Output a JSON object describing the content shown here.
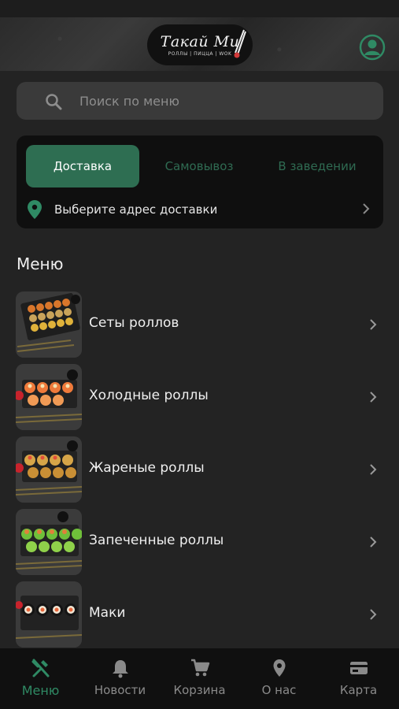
{
  "header": {
    "brand_name": "Такай Ми",
    "brand_tagline": "РОЛЛЫ | ПИЦЦА | WOK",
    "profile_icon": "user-circle-icon"
  },
  "search": {
    "placeholder": "Поиск по меню",
    "icon": "search-icon"
  },
  "delivery": {
    "tabs": [
      {
        "label": "Доставка",
        "active": true
      },
      {
        "label": "Самовывоз",
        "active": false
      },
      {
        "label": "В заведении",
        "active": false
      }
    ],
    "address_prompt": "Выберите адрес доставки",
    "address_icon": "map-pin-icon"
  },
  "menu": {
    "title": "Меню",
    "items": [
      {
        "label": "Сеты роллов"
      },
      {
        "label": "Холодные роллы"
      },
      {
        "label": "Жареные роллы"
      },
      {
        "label": "Запеченные роллы"
      },
      {
        "label": "Маки"
      }
    ]
  },
  "tabbar": {
    "items": [
      {
        "label": "Меню",
        "icon": "fork-knife-icon",
        "active": true
      },
      {
        "label": "Новости",
        "icon": "bell-icon",
        "active": false
      },
      {
        "label": "Корзина",
        "icon": "cart-icon",
        "active": false
      },
      {
        "label": "О нас",
        "icon": "map-pin-icon",
        "active": false
      },
      {
        "label": "Карта",
        "icon": "credit-card-icon",
        "active": false
      }
    ]
  },
  "colors": {
    "background": "#232323",
    "accent": "#2e6e52",
    "accent_text": "#2f8a64",
    "card": "#0f0f0f",
    "search_bg": "#3a3a3a"
  }
}
